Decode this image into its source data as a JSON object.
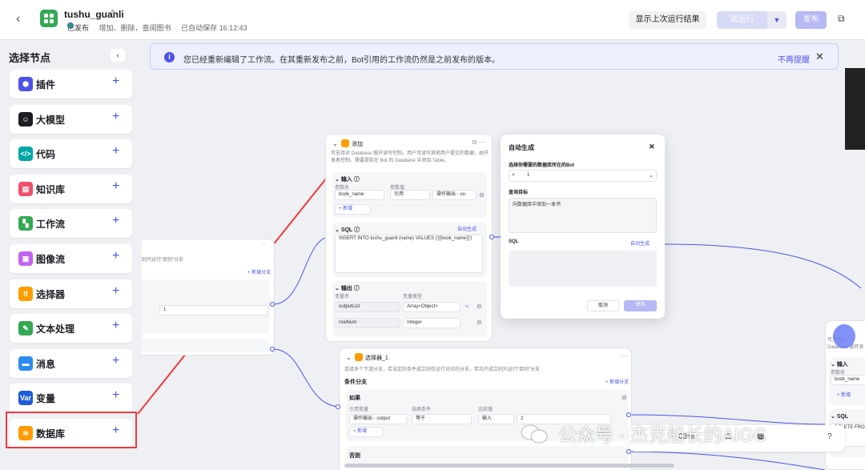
{
  "header": {
    "app_name": "tushu_guanli",
    "status": "已发布",
    "description": "增加、删除，查阅图书",
    "autosave": "已自动保存 16:12:43",
    "btn_last_run": "显示上次运行结果",
    "btn_try_run": "试运行",
    "btn_publish": "发布"
  },
  "sidebar": {
    "title": "选择节点",
    "items": [
      {
        "label": "插件",
        "color": "#4d53e8",
        "icon": "⬢"
      },
      {
        "label": "大模型",
        "color": "#1c1d23",
        "icon": "☺"
      },
      {
        "label": "代码",
        "color": "#00a6a6",
        "icon": "</>"
      },
      {
        "label": "知识库",
        "color": "#f0506b",
        "icon": "▤"
      },
      {
        "label": "工作流",
        "color": "#34a853",
        "icon": "▚"
      },
      {
        "label": "图像流",
        "color": "#c064f0",
        "icon": "▣"
      },
      {
        "label": "选择器",
        "color": "#ff9d00",
        "icon": "If"
      },
      {
        "label": "文本处理",
        "color": "#34a853",
        "icon": "✎"
      },
      {
        "label": "消息",
        "color": "#2d8cf0",
        "icon": "▬"
      },
      {
        "label": "变量",
        "color": "#1e5bd8",
        "icon": "Var"
      },
      {
        "label": "数据库",
        "color": "#ff9d00",
        "icon": "≋"
      }
    ]
  },
  "notice": {
    "text": "您已经重新编辑了工作流。在其重新发布之前，Bot引用的工作流仍然是之前发布的版本。",
    "dismiss": "不再提醒"
  },
  "db_node": {
    "title": "添加",
    "desc": "可支持对 Database 做开读写控制。用户可读写其他用户提交的数据，由开发者控制。需要提前在 Bot 的 Database 中添加 Table。",
    "input": {
      "label": "输入",
      "col_name": "参数名",
      "col_value": "参数值",
      "param": "book_name",
      "ref": "引用",
      "ref_src": "操作输出 - ou",
      "add": "+ 新增"
    },
    "sql": {
      "label": "SQL",
      "auto": "自动生成",
      "code": "INSERT INTO tushu_guanli (name) VALUES ('{{book_name}}')"
    },
    "output": {
      "label": "输出",
      "col_name": "变量名",
      "col_type": "变量类型",
      "rows": [
        {
          "name": "outputList",
          "type": "Array<Object>"
        },
        {
          "name": "rowNum",
          "type": "Integer"
        }
      ]
    }
  },
  "selector_node": {
    "title": "选择器_1",
    "desc": "连接多个下游分支，若设定的条件成立则仅运行对应的分支，若均不成立则只运行“否则”分支",
    "branch": "条件分支",
    "add_branch": "+ 新增分支",
    "if_label": "如果",
    "col_ref": "引用变量",
    "col_cond": "选择条件",
    "col_cmp": "比较值",
    "ref_value": "操作输出 - output",
    "cond": "等于",
    "cmp_type": "输入",
    "cmp_value": "2",
    "add": "+ 新增",
    "else": "否则"
  },
  "left_node": {
    "hint": "则只运行“否则”分支",
    "add_branch": "+ 新增分支",
    "value": "1"
  },
  "modal": {
    "title": "自动生成",
    "select_label": "选择你需要的数据库所在的Bot",
    "bot_value": "1",
    "query_label": "查询目标",
    "query_value": "向数据库中添加一本书",
    "sql_label": "SQL",
    "auto": "自动生成",
    "cancel": "取消",
    "apply": "使用"
  },
  "right_node": {
    "desc": "可支持对 Database 做开发者控制。",
    "input": "输入",
    "col": "参数名",
    "param": "book_name",
    "add": "+ 新增",
    "sql": "SQL",
    "code": "DELETE FROM"
  },
  "toolbar": {
    "zoom": "63%"
  },
  "watermark": "公众号 · 杰克船长的AIGC"
}
